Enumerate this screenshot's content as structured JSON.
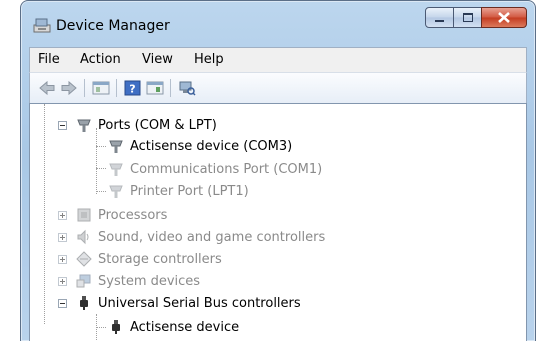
{
  "window": {
    "title": "Device Manager"
  },
  "menu": [
    "File",
    "Action",
    "View",
    "Help"
  ],
  "toolbar": {
    "buttons": [
      "back-arrow-icon",
      "forward-arrow-icon",
      "properties-icon",
      "help-icon",
      "update-driver-icon",
      "scan-hardware-icon"
    ]
  },
  "tree": {
    "ports": {
      "label": "Ports (COM & LPT)",
      "children": [
        "Actisense device (COM3)",
        "Communications Port (COM1)",
        "Printer Port (LPT1)"
      ]
    },
    "processors": "Processors",
    "sound": "Sound, video and game controllers",
    "storage": "Storage controllers",
    "system": "System devices",
    "usb": {
      "label": "Universal Serial Bus controllers",
      "children": [
        "Actisense device"
      ]
    }
  }
}
